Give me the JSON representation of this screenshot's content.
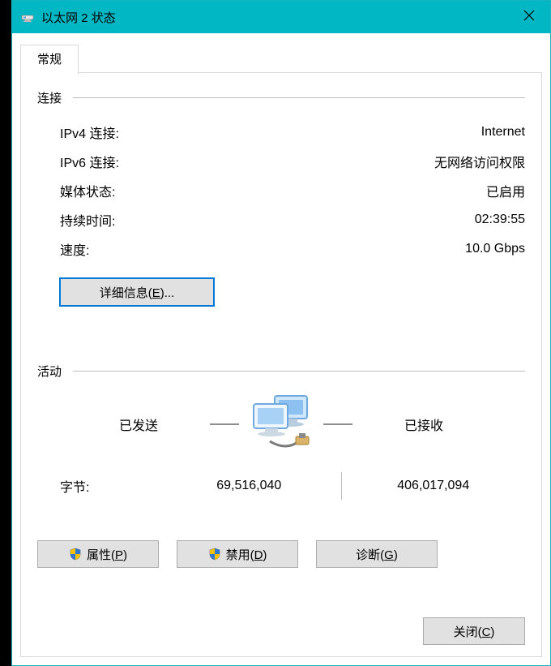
{
  "window": {
    "title": "以太网 2 状态"
  },
  "tab": {
    "general": "常规"
  },
  "connection": {
    "heading": "连接",
    "ipv4_label": "IPv4 连接:",
    "ipv4_value": "Internet",
    "ipv6_label": "IPv6 连接:",
    "ipv6_value": "无网络访问权限",
    "media_label": "媒体状态:",
    "media_value": "已启用",
    "duration_label": "持续时间:",
    "duration_value": "02:39:55",
    "speed_label": "速度:",
    "speed_value": "10.0 Gbps",
    "details_button_prefix": "详细信息(",
    "details_button_hotkey": "E",
    "details_button_suffix": ")..."
  },
  "activity": {
    "heading": "活动",
    "sent_label": "已发送",
    "recv_label": "已接收",
    "bytes_label": "字节:",
    "bytes_sent": "69,516,040",
    "bytes_recv": "406,017,094"
  },
  "buttons": {
    "properties_prefix": "属性(",
    "properties_hot": "P",
    "properties_suffix": ")",
    "disable_prefix": "禁用(",
    "disable_hot": "D",
    "disable_suffix": ")",
    "diagnose_prefix": "诊断(",
    "diagnose_hot": "G",
    "diagnose_suffix": ")",
    "close_prefix": "关闭(",
    "close_hot": "C",
    "close_suffix": ")"
  }
}
